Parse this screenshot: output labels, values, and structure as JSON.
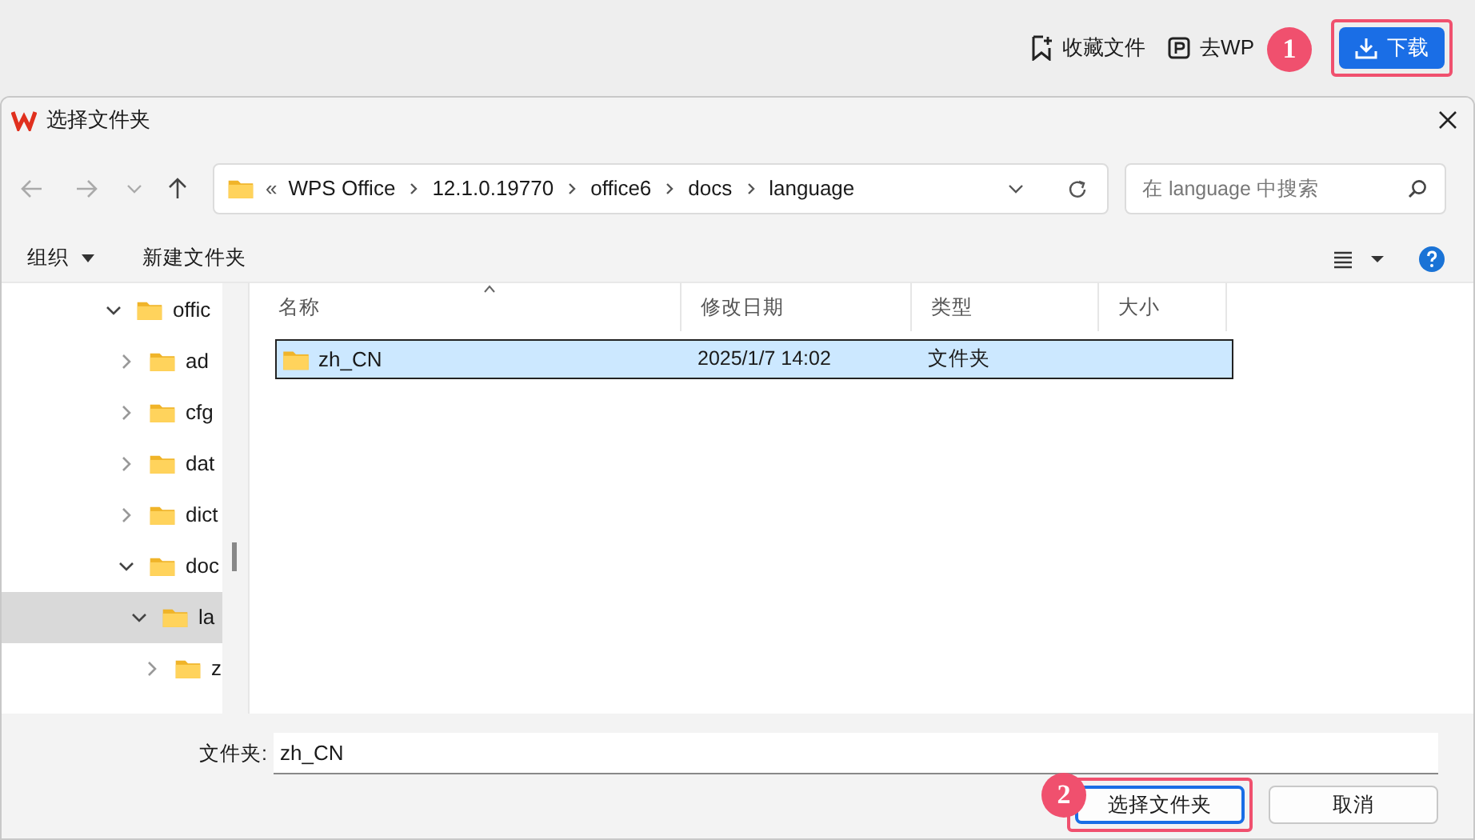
{
  "top_bar": {
    "buttons": [
      {
        "kind": "bookmark",
        "label": "收藏文件"
      },
      {
        "kind": "p",
        "label": "去WP"
      },
      {
        "kind": "download",
        "label": "下载"
      }
    ]
  },
  "callouts": [
    {
      "label": "1"
    },
    {
      "label": "2"
    }
  ],
  "dialog": {
    "title": "选择文件夹",
    "address": {
      "overflow": "«",
      "segments": [
        "WPS Office",
        "12.1.0.19770",
        "office6",
        "docs",
        "language"
      ]
    },
    "search": {
      "placeholder": "在 language 中搜索"
    },
    "toolbar": {
      "organize": "组织",
      "new_folder": "新建文件夹"
    },
    "tree": [
      {
        "label": "offic",
        "expanded": true,
        "selected": false,
        "children": [
          {
            "label": "ad",
            "expanded": false,
            "selected": false
          },
          {
            "label": "cfg",
            "expanded": false,
            "selected": false
          },
          {
            "label": "dat",
            "expanded": false,
            "selected": false
          },
          {
            "label": "dict",
            "expanded": false,
            "selected": false
          },
          {
            "label": "doc",
            "expanded": true,
            "selected": false,
            "children": [
              {
                "label": "la",
                "expanded": true,
                "selected": true,
                "children": [
                  {
                    "label": "z",
                    "expanded": false,
                    "selected": false
                  }
                ]
              }
            ]
          }
        ]
      }
    ],
    "columns": [
      "名称",
      "修改日期",
      "类型",
      "大小"
    ],
    "rows": [
      {
        "name": "zh_CN",
        "modified": "2025/1/7 14:02",
        "type": "文件夹",
        "selected": true
      }
    ],
    "folder_field": {
      "label": "文件夹:",
      "value": "zh_CN"
    },
    "buttons": [
      {
        "label": "选择文件夹",
        "default": true
      },
      {
        "label": "取消",
        "default": false
      }
    ]
  }
}
